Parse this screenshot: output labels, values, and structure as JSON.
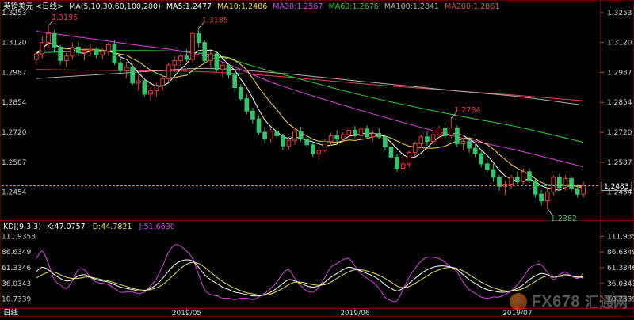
{
  "price_header": {
    "symbol": "英镑美元",
    "period": "<日线>",
    "ma_params": "MA(5,10,30,60,100,200)",
    "ma5": "MA5:1.2477",
    "ma10": "MA10:1.2486",
    "ma30": "MA30:1.2567",
    "ma60": "MA60:1.2676",
    "ma100": "MA100:1.2841",
    "ma200": "MA200:1.2861"
  },
  "kdj_header": {
    "params": "KDJ(9,3,3)",
    "k": "K:47.0757",
    "d": "D:44.7821",
    "j": "J:51.6630"
  },
  "footer": {
    "period_tab": "日线",
    "dates": [
      "2019/05",
      "2019/06",
      "2019/07"
    ]
  },
  "watermark": {
    "brand": "FX678",
    "brand_cn": "汇通网"
  },
  "colors": {
    "up": "#f03c3c",
    "down": "#36c36a",
    "ma5": "#ffffff",
    "ma10": "#ffd34d",
    "ma30": "#e040e8",
    "ma60": "#2ed12e",
    "ma100": "#b0b0b0",
    "ma200": "#d84a4a",
    "k": "#ffffff",
    "d": "#e8e05a",
    "j": "#e040e8",
    "current": "#e8a23a"
  },
  "chart_data": [
    {
      "type": "candlestick",
      "title": "英镑美元<日线>",
      "ylim": [
        1.234,
        1.3253
      ],
      "y_ticks": [
        "1.3253",
        "1.3120",
        "1.2987",
        "1.2854",
        "1.2720",
        "1.2587",
        "1.2454"
      ],
      "y_tick_values": [
        1.3253,
        1.312,
        1.2987,
        1.2854,
        1.272,
        1.2587,
        1.2454
      ],
      "x_labels": [
        {
          "label": "2019/05",
          "index": 25
        },
        {
          "label": "2019/06",
          "index": 53
        },
        {
          "label": "2019/07",
          "index": 80
        }
      ],
      "current_price_label": "1.2483",
      "current_price": 1.2483,
      "annotations": [
        {
          "text": "1.3196",
          "index": 2,
          "value": 1.3196
        },
        {
          "text": "1.3185",
          "index": 27,
          "value": 1.3185
        },
        {
          "text": "1.2784",
          "index": 69,
          "value": 1.2784
        },
        {
          "text": "1.2382",
          "index": 85,
          "value": 1.2382
        }
      ],
      "ohlc": [
        [
          1.3045,
          1.3085,
          1.3025,
          1.307
        ],
        [
          1.307,
          1.315,
          1.305,
          1.312
        ],
        [
          1.312,
          1.3196,
          1.309,
          1.316
        ],
        [
          1.316,
          1.3175,
          1.308,
          1.31
        ],
        [
          1.31,
          1.311,
          1.302,
          1.304
        ],
        [
          1.304,
          1.3075,
          1.301,
          1.306
        ],
        [
          1.306,
          1.312,
          1.3045,
          1.31
        ],
        [
          1.31,
          1.3125,
          1.306,
          1.3075
        ],
        [
          1.3075,
          1.3095,
          1.304,
          1.3085
        ],
        [
          1.3085,
          1.3115,
          1.306,
          1.309
        ],
        [
          1.309,
          1.31,
          1.305,
          1.3065
        ],
        [
          1.3065,
          1.3095,
          1.3045,
          1.308
        ],
        [
          1.308,
          1.312,
          1.306,
          1.311
        ],
        [
          1.311,
          1.313,
          1.302,
          1.303
        ],
        [
          1.303,
          1.3045,
          1.298,
          1.2995
        ],
        [
          1.2995,
          1.3035,
          1.296,
          1.301
        ],
        [
          1.301,
          1.3025,
          1.293,
          1.294
        ],
        [
          1.294,
          1.2975,
          1.2905,
          1.295
        ],
        [
          1.295,
          1.296,
          1.288,
          1.289
        ],
        [
          1.289,
          1.292,
          1.286,
          1.2905
        ],
        [
          1.2905,
          1.294,
          1.288,
          1.293
        ],
        [
          1.293,
          1.2975,
          1.2905,
          1.296
        ],
        [
          1.296,
          1.303,
          1.2945,
          1.302
        ],
        [
          1.302,
          1.306,
          1.299,
          1.304
        ],
        [
          1.304,
          1.307,
          1.3015,
          1.306
        ],
        [
          1.306,
          1.309,
          1.3035,
          1.3045
        ],
        [
          1.3045,
          1.317,
          1.303,
          1.316
        ],
        [
          1.316,
          1.3185,
          1.31,
          1.312
        ],
        [
          1.312,
          1.313,
          1.303,
          1.304
        ],
        [
          1.304,
          1.3085,
          1.301,
          1.307
        ],
        [
          1.307,
          1.308,
          1.299,
          1.3
        ],
        [
          1.3,
          1.303,
          1.2965,
          1.302
        ],
        [
          1.302,
          1.303,
          1.296,
          1.2975
        ],
        [
          1.2975,
          1.2985,
          1.29,
          1.292
        ],
        [
          1.292,
          1.2935,
          1.286,
          1.287
        ],
        [
          1.287,
          1.289,
          1.28,
          1.2815
        ],
        [
          1.2815,
          1.283,
          1.276,
          1.278
        ],
        [
          1.278,
          1.2795,
          1.271,
          1.272
        ],
        [
          1.272,
          1.2745,
          1.267,
          1.269
        ],
        [
          1.269,
          1.274,
          1.2675,
          1.2725
        ],
        [
          1.2725,
          1.274,
          1.269,
          1.2705
        ],
        [
          1.2705,
          1.2715,
          1.264,
          1.266
        ],
        [
          1.266,
          1.27,
          1.2645,
          1.2685
        ],
        [
          1.2685,
          1.274,
          1.2665,
          1.2725
        ],
        [
          1.2725,
          1.2745,
          1.268,
          1.269
        ],
        [
          1.269,
          1.2705,
          1.265,
          1.2665
        ],
        [
          1.2665,
          1.2675,
          1.261,
          1.2625
        ],
        [
          1.2625,
          1.2655,
          1.26,
          1.264
        ],
        [
          1.264,
          1.269,
          1.263,
          1.268
        ],
        [
          1.268,
          1.272,
          1.266,
          1.2705
        ],
        [
          1.2705,
          1.273,
          1.2675,
          1.269
        ],
        [
          1.269,
          1.272,
          1.267,
          1.271
        ],
        [
          1.271,
          1.2745,
          1.269,
          1.273
        ],
        [
          1.273,
          1.275,
          1.2695,
          1.2705
        ],
        [
          1.2705,
          1.2745,
          1.269,
          1.2735
        ],
        [
          1.2735,
          1.275,
          1.269,
          1.27
        ],
        [
          1.27,
          1.273,
          1.268,
          1.2715
        ],
        [
          1.2715,
          1.274,
          1.269,
          1.27
        ],
        [
          1.27,
          1.271,
          1.264,
          1.2655
        ],
        [
          1.2655,
          1.267,
          1.2595,
          1.261
        ],
        [
          1.261,
          1.2625,
          1.2545,
          1.256
        ],
        [
          1.256,
          1.26,
          1.254,
          1.258
        ],
        [
          1.258,
          1.264,
          1.2565,
          1.263
        ],
        [
          1.263,
          1.268,
          1.261,
          1.267
        ],
        [
          1.267,
          1.271,
          1.265,
          1.27
        ],
        [
          1.27,
          1.2725,
          1.266,
          1.268
        ],
        [
          1.268,
          1.2725,
          1.2665,
          1.271
        ],
        [
          1.271,
          1.275,
          1.269,
          1.274
        ],
        [
          1.274,
          1.2765,
          1.269,
          1.2705
        ],
        [
          1.2705,
          1.2784,
          1.2695,
          1.274
        ],
        [
          1.274,
          1.275,
          1.2655,
          1.267
        ],
        [
          1.267,
          1.2695,
          1.264,
          1.268
        ],
        [
          1.268,
          1.27,
          1.263,
          1.265
        ],
        [
          1.265,
          1.267,
          1.261,
          1.2625
        ],
        [
          1.2625,
          1.264,
          1.2565,
          1.258
        ],
        [
          1.258,
          1.26,
          1.254,
          1.2555
        ],
        [
          1.2555,
          1.258,
          1.25,
          1.252
        ],
        [
          1.252,
          1.253,
          1.246,
          1.248
        ],
        [
          1.248,
          1.2505,
          1.244,
          1.249
        ],
        [
          1.249,
          1.253,
          1.247,
          1.252
        ],
        [
          1.252,
          1.2545,
          1.249,
          1.25
        ],
        [
          1.25,
          1.256,
          1.249,
          1.2545
        ],
        [
          1.2545,
          1.256,
          1.2495,
          1.2505
        ],
        [
          1.2505,
          1.2515,
          1.243,
          1.2445
        ],
        [
          1.2445,
          1.2465,
          1.2395,
          1.2415
        ],
        [
          1.2415,
          1.247,
          1.2382,
          1.2455
        ],
        [
          1.2455,
          1.253,
          1.244,
          1.252
        ],
        [
          1.252,
          1.2535,
          1.246,
          1.2475
        ],
        [
          1.2475,
          1.253,
          1.246,
          1.2515
        ],
        [
          1.2515,
          1.2525,
          1.246,
          1.247
        ],
        [
          1.247,
          1.249,
          1.243,
          1.2445
        ],
        [
          1.2445,
          1.25,
          1.243,
          1.2483
        ]
      ],
      "ma": {
        "ma30": [
          [
            0,
            1.317
          ],
          [
            15,
            1.3115
          ],
          [
            28,
            1.306
          ],
          [
            40,
            1.2935
          ],
          [
            55,
            1.281
          ],
          [
            70,
            1.27
          ],
          [
            80,
            1.264
          ],
          [
            91,
            1.2567
          ]
        ],
        "ma60": [
          [
            0,
            1.3075
          ],
          [
            15,
            1.3085
          ],
          [
            28,
            1.307
          ],
          [
            40,
            1.2985
          ],
          [
            55,
            1.288
          ],
          [
            70,
            1.2795
          ],
          [
            80,
            1.2745
          ],
          [
            91,
            1.2676
          ]
        ],
        "ma100": [
          [
            0,
            1.296
          ],
          [
            15,
            1.2985
          ],
          [
            28,
            1.3005
          ],
          [
            40,
            1.2985
          ],
          [
            55,
            1.2945
          ],
          [
            70,
            1.2905
          ],
          [
            80,
            1.288
          ],
          [
            91,
            1.2841
          ]
        ],
        "ma200": [
          [
            0,
            1.3
          ],
          [
            15,
            1.2995
          ],
          [
            28,
            1.299
          ],
          [
            40,
            1.297
          ],
          [
            55,
            1.2935
          ],
          [
            70,
            1.2905
          ],
          [
            80,
            1.2885
          ],
          [
            91,
            1.2861
          ]
        ]
      }
    },
    {
      "type": "line",
      "title": "KDJ(9,3,3)",
      "ylim": [
        0,
        120
      ],
      "y_ticks": [
        "111.9353",
        "86.6349",
        "61.3346",
        "36.0343",
        "10.7339"
      ],
      "y_tick_values": [
        111.9353,
        86.6349,
        61.3346,
        36.0343,
        10.7339
      ],
      "series": [
        {
          "name": "K",
          "values": [
            55,
            62,
            58,
            50,
            44,
            40,
            42,
            48,
            50,
            46,
            42,
            40,
            38,
            34,
            30,
            28,
            26,
            24,
            24,
            28,
            34,
            44,
            56,
            66,
            72,
            74,
            72,
            62,
            50,
            42,
            36,
            30,
            26,
            22,
            20,
            18,
            16,
            16,
            18,
            22,
            28,
            36,
            42,
            40,
            36,
            32,
            30,
            32,
            38,
            46,
            52,
            58,
            62,
            60,
            56,
            52,
            48,
            42,
            34,
            28,
            24,
            28,
            36,
            44,
            52,
            58,
            62,
            64,
            64,
            62,
            58,
            50,
            42,
            36,
            30,
            26,
            24,
            22,
            22,
            24,
            28,
            34,
            42,
            48,
            52,
            50,
            46,
            48,
            50,
            48,
            46,
            47
          ]
        },
        {
          "name": "D",
          "values": [
            45,
            50,
            54,
            54,
            50,
            46,
            44,
            44,
            46,
            46,
            44,
            42,
            40,
            37,
            34,
            31,
            28,
            26,
            25,
            26,
            29,
            34,
            42,
            51,
            60,
            67,
            70,
            68,
            62,
            54,
            46,
            39,
            33,
            28,
            24,
            21,
            19,
            17,
            17,
            19,
            23,
            28,
            34,
            38,
            38,
            36,
            34,
            33,
            34,
            38,
            44,
            50,
            55,
            58,
            58,
            56,
            53,
            49,
            44,
            38,
            32,
            29,
            31,
            36,
            42,
            48,
            54,
            58,
            61,
            62,
            60,
            56,
            50,
            44,
            38,
            33,
            29,
            26,
            24,
            24,
            25,
            28,
            33,
            39,
            45,
            48,
            48,
            47,
            48,
            48,
            47,
            44.8
          ]
        },
        {
          "name": "J",
          "values": [
            76,
            88,
            68,
            42,
            34,
            28,
            40,
            58,
            58,
            46,
            38,
            36,
            34,
            28,
            22,
            22,
            22,
            20,
            22,
            32,
            44,
            64,
            86,
            98,
            96,
            88,
            76,
            50,
            26,
            18,
            16,
            12,
            12,
            10,
            12,
            12,
            10,
            14,
            20,
            28,
            38,
            52,
            58,
            44,
            32,
            24,
            22,
            30,
            46,
            62,
            68,
            74,
            76,
            64,
            52,
            44,
            38,
            28,
            14,
            8,
            8,
            26,
            46,
            60,
            72,
            78,
            78,
            76,
            70,
            62,
            54,
            38,
            26,
            20,
            14,
            12,
            14,
            14,
            18,
            24,
            34,
            46,
            60,
            66,
            66,
            54,
            42,
            50,
            54,
            48,
            44,
            51.7
          ]
        }
      ]
    }
  ]
}
